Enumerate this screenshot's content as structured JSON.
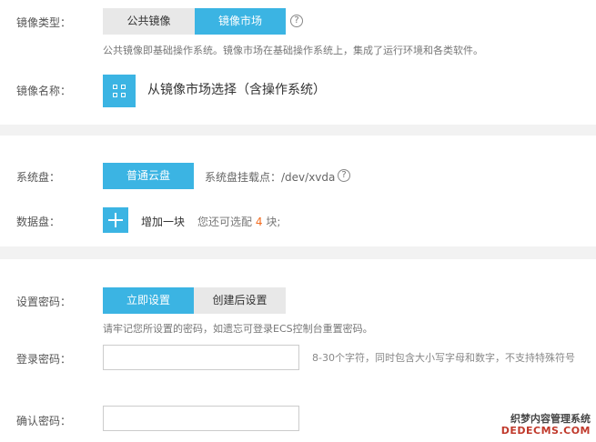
{
  "image": {
    "label": "镜像类型：",
    "tabs": [
      "公共镜像",
      "镜像市场"
    ],
    "help": "?",
    "hint": "公共镜像即基础操作系统。镜像市场在基础操作系统上，集成了运行环境和各类软件。"
  },
  "image_name": {
    "label": "镜像名称：",
    "select_text": "从镜像市场选择（含操作系统）"
  },
  "system_disk": {
    "label": "系统盘：",
    "type_button": "普通云盘",
    "mount_text": "系统盘挂载点：/dev/xvda",
    "help": "?"
  },
  "data_disk": {
    "label": "数据盘：",
    "add_label": "增加一块",
    "remaining_prefix": "您还可选配",
    "remaining_count": "4",
    "remaining_suffix": "块;"
  },
  "password": {
    "label": "设置密码：",
    "tabs": [
      "立即设置",
      "创建后设置"
    ],
    "hint": "请牢记您所设置的密码，如遗忘可登录ECS控制台重置密码。",
    "login_label": "登录密码：",
    "login_value": "",
    "login_note": "8-30个字符，同时包含大小写字母和数字，不支持特殊符号",
    "confirm_label": "确认密码：",
    "confirm_value": ""
  },
  "watermark": {
    "line1": "织梦内容管理系统",
    "line2": "DEDECMS.COM"
  },
  "colors": {
    "accent": "#3bb4e3",
    "orange": "#f36b1e"
  }
}
